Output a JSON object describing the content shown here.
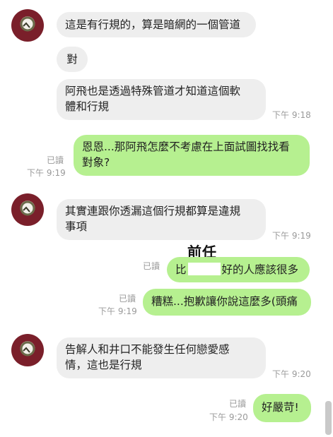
{
  "messages": [
    {
      "side": "in",
      "text": "這是有行規的，算是暗網的一個管道"
    },
    {
      "side": "in",
      "text": "對"
    },
    {
      "side": "in",
      "text": "阿飛也是透過特殊管道才知道這個軟體和行規",
      "line1": "阿飛也是透過特殊管道才知道這個軟",
      "line2": "體和行規",
      "time": "下午 9:18"
    },
    {
      "side": "out",
      "line1": "恩恩...那阿飛怎麼不考慮在上面試圖找找看",
      "line2": "對象?",
      "read": "已讀",
      "time": "下午 9:19"
    },
    {
      "side": "in",
      "line1": "其實連跟你透漏這個行規都算是違規",
      "line2": "事項",
      "time": "下午 9:19"
    },
    {
      "side": "out",
      "text_before": "比",
      "text_after": "好的人應該很多",
      "read": "已讀"
    },
    {
      "side": "out",
      "text": "糟糕...抱歉讓你說這麼多(頭痛",
      "read": "已讀",
      "time": "下午 9:19"
    },
    {
      "side": "in",
      "line1": "告解人和井口不能發生任何戀愛感",
      "line2": "情，這也是行規",
      "time": "下午 9:20"
    },
    {
      "side": "out",
      "text": "好嚴苛!",
      "read": "已讀",
      "time": "下午 9:20"
    }
  ],
  "annotation": "前任",
  "avatar_icon": "profile-avatar-icon",
  "colors": {
    "incoming_bubble": "#eeeeee",
    "outgoing_bubble": "#b6f090",
    "timestamp": "#9a9a9a"
  }
}
